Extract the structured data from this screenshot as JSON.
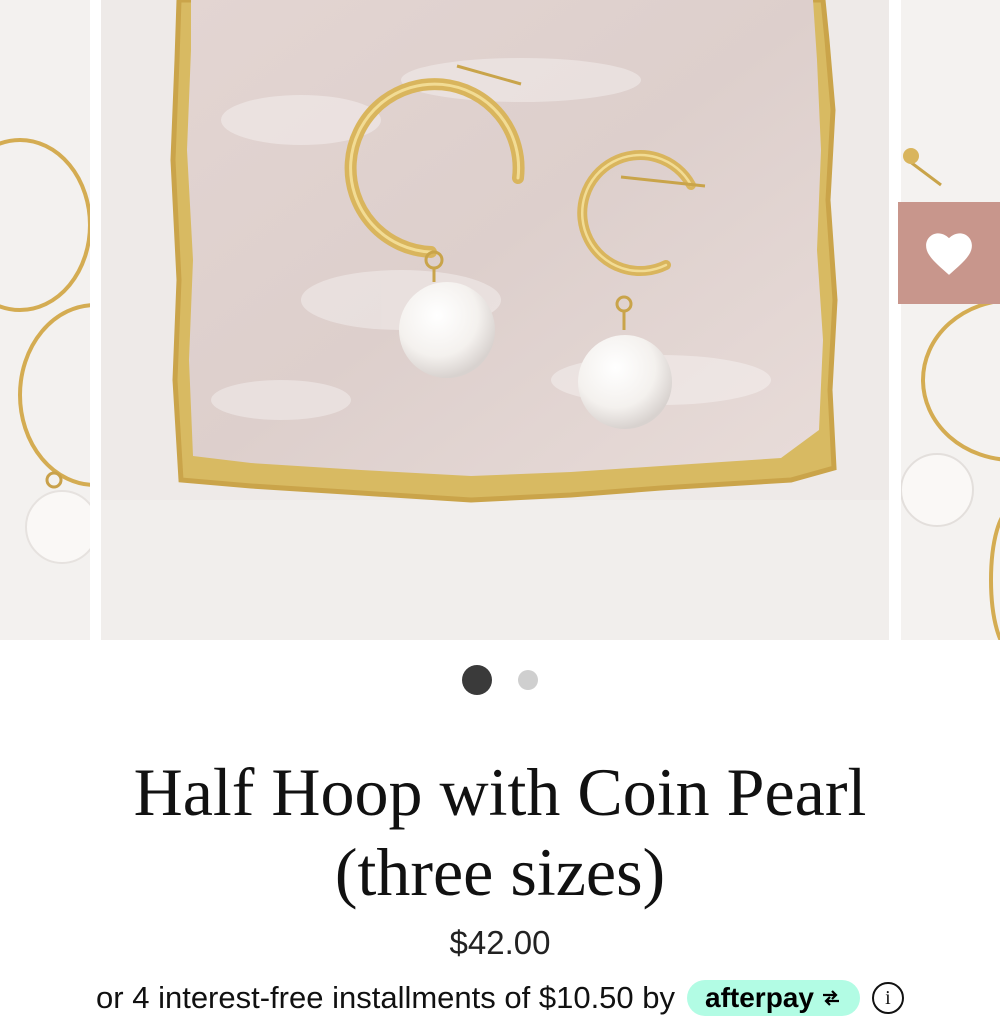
{
  "product": {
    "title_line1": "Half Hoop with Coin Pearl",
    "title_line2": "(three sizes)",
    "price": "$42.00"
  },
  "afterpay": {
    "text": "or 4 interest-free installments of $10.50 by",
    "badge_label": "afterpay",
    "badge_icon": "afterpay-arrows-icon",
    "info_icon": "info-icon"
  },
  "carousel": {
    "slide_count": 2,
    "active_index": 0,
    "wishlist_icon": "heart-icon"
  },
  "colors": {
    "wishlist_bg": "#c8968c",
    "afterpay_bg": "#b2fce4",
    "dot_active": "#3a3a3a",
    "dot_inactive": "#cfcfcf"
  }
}
